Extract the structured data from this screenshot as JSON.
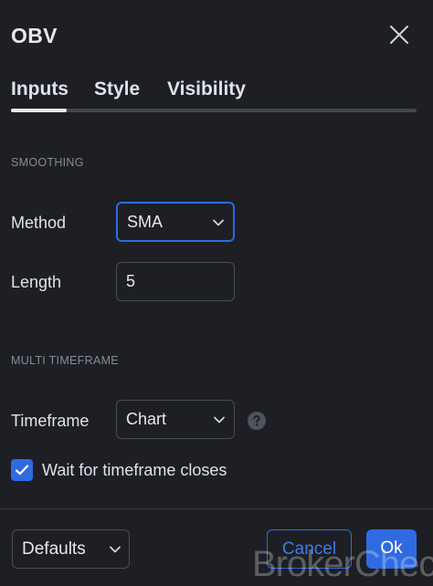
{
  "dialog": {
    "title": "OBV"
  },
  "tabs": [
    {
      "label": "Inputs",
      "active": true
    },
    {
      "label": "Style",
      "active": false
    },
    {
      "label": "Visibility",
      "active": false
    }
  ],
  "smoothing": {
    "section_label": "SMOOTHING",
    "method": {
      "label": "Method",
      "value": "SMA"
    },
    "length": {
      "label": "Length",
      "value": "5"
    }
  },
  "multi_timeframe": {
    "section_label": "MULTI TIMEFRAME",
    "timeframe": {
      "label": "Timeframe",
      "value": "Chart"
    },
    "wait_for_closes": {
      "label": "Wait for timeframe closes",
      "checked": true
    }
  },
  "footer": {
    "defaults_label": "Defaults",
    "cancel_label": "Cancel",
    "ok_label": "Ok"
  },
  "watermark": {
    "text": "BrokerCheck"
  },
  "icons": {
    "close": "close-icon",
    "chevron": "chevron-down-icon",
    "help": "help-icon",
    "check": "check-icon"
  },
  "colors": {
    "background": "#1e1f24",
    "accent": "#2f6be0",
    "text": "#dfe2ea",
    "muted": "#878b95",
    "border": "#4a4d55"
  }
}
